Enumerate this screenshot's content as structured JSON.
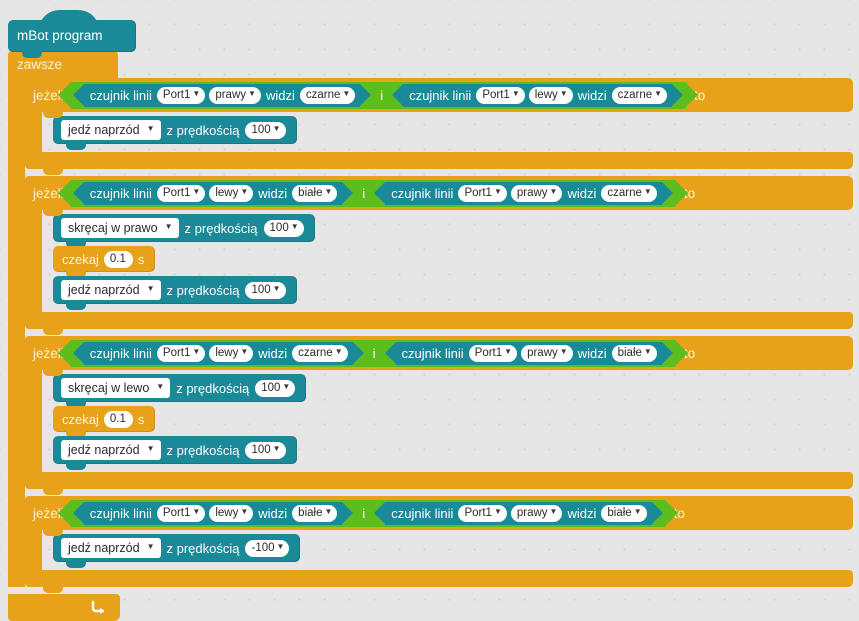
{
  "colors": {
    "background": "#e6e6e6",
    "control_orange": "#e8a219",
    "sensor_teal": "#1a8a99",
    "operator_green": "#5bbd1e",
    "text_light": "#fdf3da",
    "text_white": "#ffffff",
    "field_white": "#ffffff"
  },
  "hat": {
    "label": "mBot program"
  },
  "forever": {
    "label": "zawsze",
    "loop_arrow_icon": "loop-arrow-icon"
  },
  "words": {
    "if": "jeżeli",
    "then": "to",
    "and": "i",
    "sensor_name": "czujnik linii",
    "sees": "widzi",
    "with_speed": "z prędkością",
    "wait": "czekaj",
    "seconds": "s",
    "caret_icon": "chevron-down-icon"
  },
  "blocks": [
    {
      "id": "if-1",
      "condition": {
        "left": {
          "sensor": "czujnik linii",
          "port": "Port1",
          "side": "prawy",
          "sees": "widzi",
          "color": "czarne"
        },
        "operator": "i",
        "right": {
          "sensor": "czujnik linii",
          "port": "Port1",
          "side": "lewy",
          "sees": "widzi",
          "color": "czarne"
        }
      },
      "body": [
        {
          "kind": "motion",
          "action": "jedź naprzód",
          "speed_label": "z prędkością",
          "speed": "100"
        }
      ]
    },
    {
      "id": "if-2",
      "condition": {
        "left": {
          "sensor": "czujnik linii",
          "port": "Port1",
          "side": "lewy",
          "sees": "widzi",
          "color": "białe"
        },
        "operator": "i",
        "right": {
          "sensor": "czujnik linii",
          "port": "Port1",
          "side": "prawy",
          "sees": "widzi",
          "color": "czarne"
        }
      },
      "body": [
        {
          "kind": "motion",
          "action": "skręcaj w prawo",
          "speed_label": "z prędkością",
          "speed": "100"
        },
        {
          "kind": "wait",
          "label": "czekaj",
          "value": "0.1",
          "unit": "s"
        },
        {
          "kind": "motion",
          "action": "jedź naprzód",
          "speed_label": "z prędkością",
          "speed": "100"
        }
      ]
    },
    {
      "id": "if-3",
      "condition": {
        "left": {
          "sensor": "czujnik linii",
          "port": "Port1",
          "side": "lewy",
          "sees": "widzi",
          "color": "czarne"
        },
        "operator": "i",
        "right": {
          "sensor": "czujnik linii",
          "port": "Port1",
          "side": "prawy",
          "sees": "widzi",
          "color": "białe"
        }
      },
      "body": [
        {
          "kind": "motion",
          "action": "skręcaj w lewo",
          "speed_label": "z prędkością",
          "speed": "100"
        },
        {
          "kind": "wait",
          "label": "czekaj",
          "value": "0.1",
          "unit": "s"
        },
        {
          "kind": "motion",
          "action": "jedź naprzód",
          "speed_label": "z prędkością",
          "speed": "100"
        }
      ]
    },
    {
      "id": "if-4",
      "condition": {
        "left": {
          "sensor": "czujnik linii",
          "port": "Port1",
          "side": "lewy",
          "sees": "widzi",
          "color": "białe"
        },
        "operator": "i",
        "right": {
          "sensor": "czujnik linii",
          "port": "Port1",
          "side": "prawy",
          "sees": "widzi",
          "color": "białe"
        }
      },
      "body": [
        {
          "kind": "motion",
          "action": "jedź naprzód",
          "speed_label": "z prędkością",
          "speed": "-100"
        }
      ]
    }
  ]
}
